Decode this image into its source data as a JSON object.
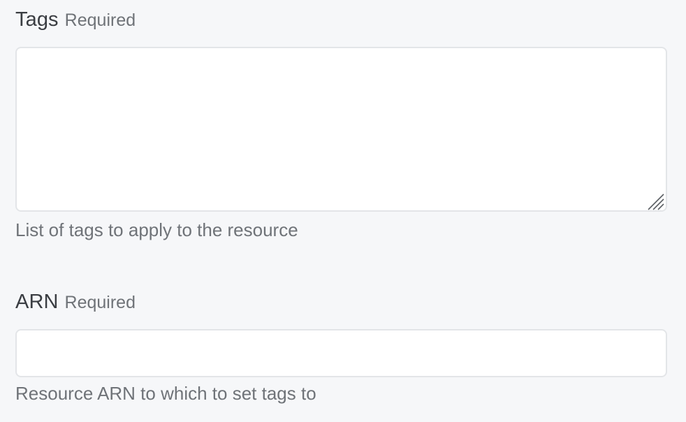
{
  "tags_field": {
    "label": "Tags",
    "required": "Required",
    "value": "",
    "placeholder": "",
    "help": "List of tags to apply to the resource"
  },
  "arn_field": {
    "label": "ARN",
    "required": "Required",
    "value": "",
    "placeholder": "",
    "help": "Resource ARN to which to set tags to"
  },
  "icons": {
    "resize_handle": "resize-grip-icon"
  },
  "colors": {
    "background": "#f6f7f9",
    "field_border": "#e3e5e8",
    "label": "#3a3d42",
    "secondary_text": "#6f7378"
  }
}
